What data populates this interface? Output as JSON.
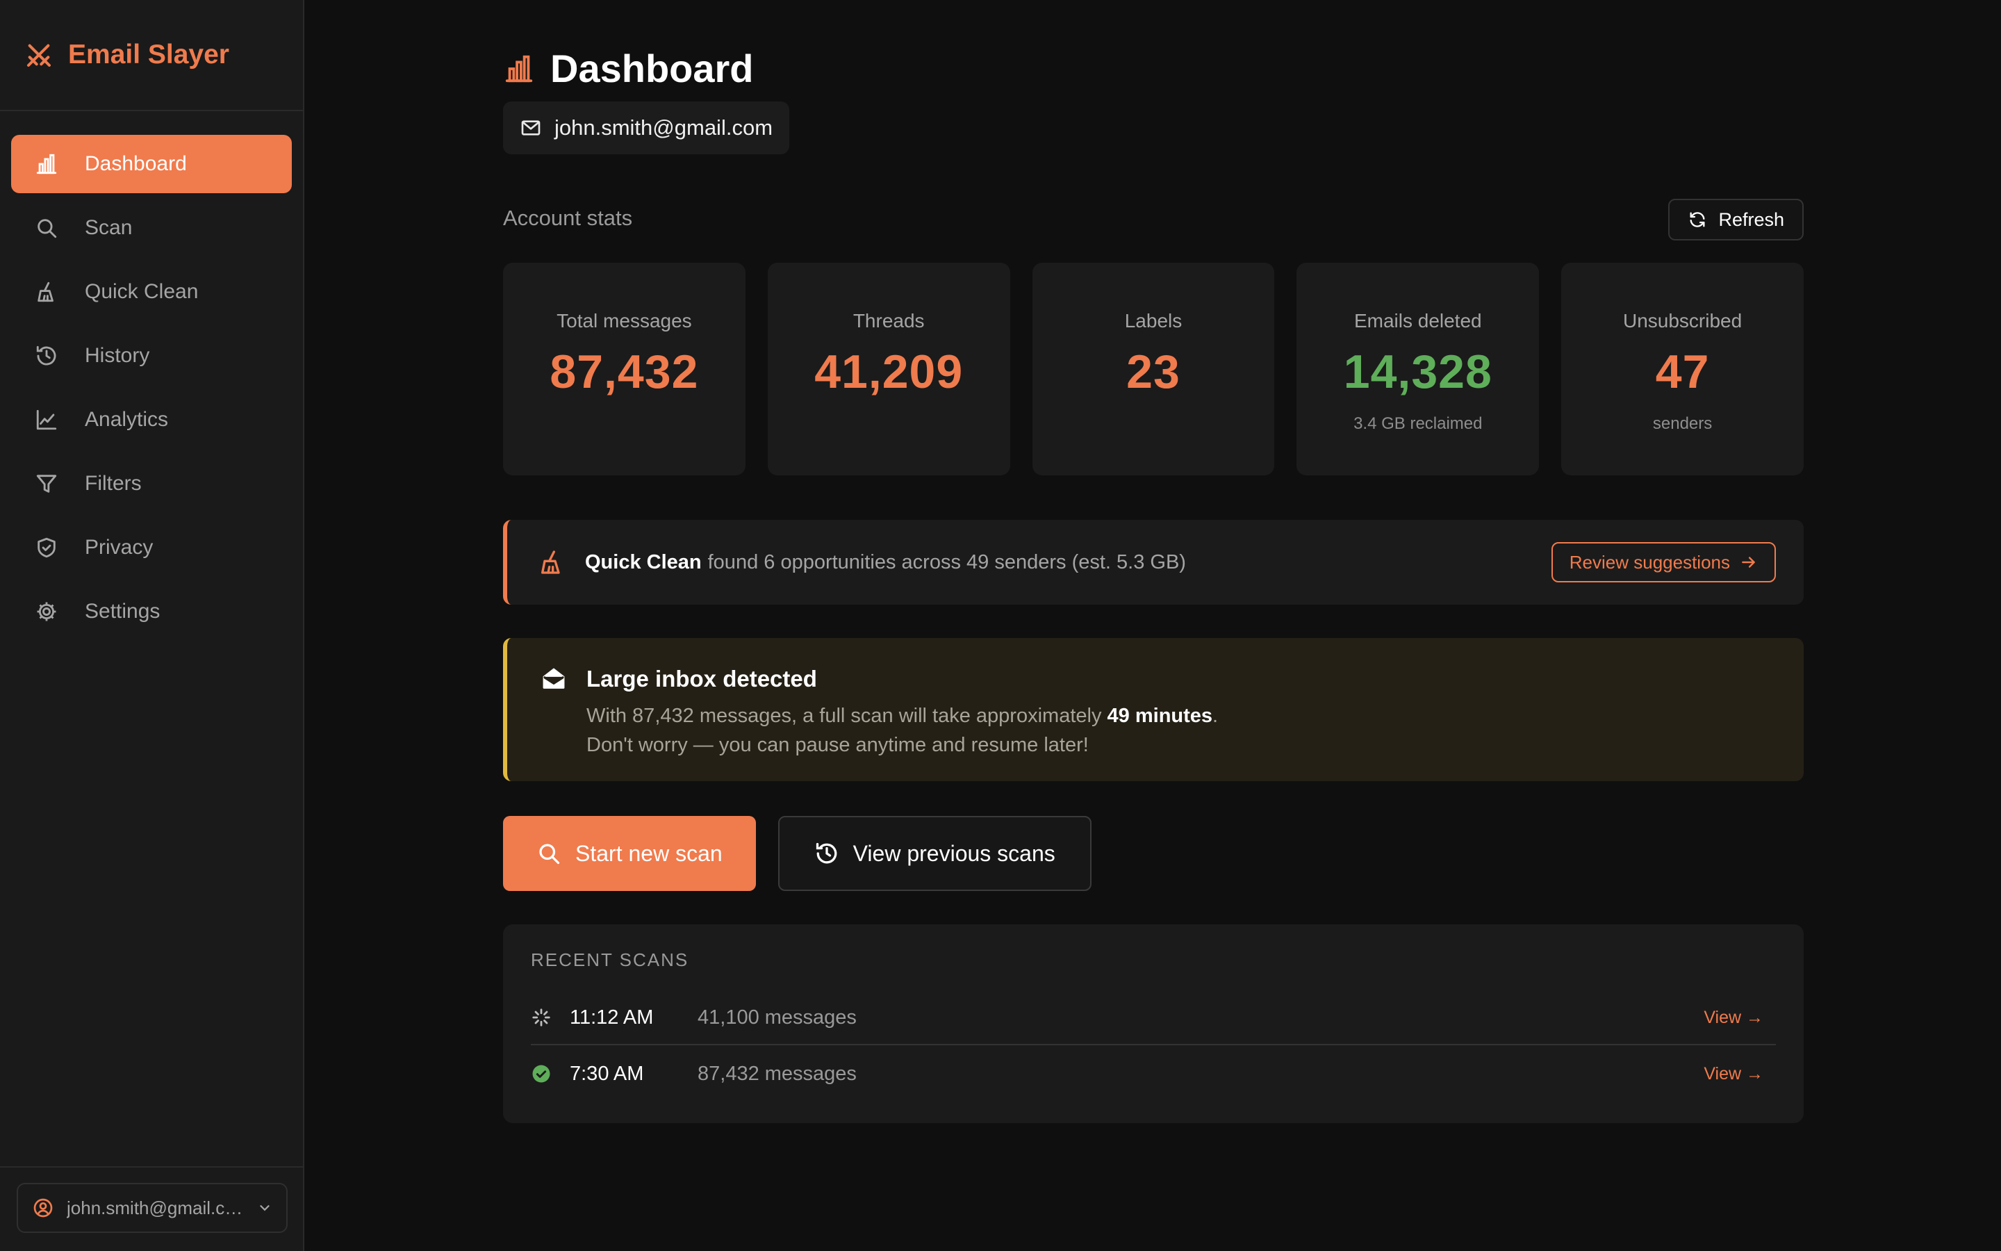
{
  "app": {
    "name": "Email Slayer"
  },
  "sidebar": {
    "items": [
      {
        "label": "Dashboard",
        "icon": "bar-chart-icon",
        "active": true
      },
      {
        "label": "Scan",
        "icon": "search-icon"
      },
      {
        "label": "Quick Clean",
        "icon": "broom-icon"
      },
      {
        "label": "History",
        "icon": "history-icon"
      },
      {
        "label": "Analytics",
        "icon": "line-chart-icon"
      },
      {
        "label": "Filters",
        "icon": "filter-icon"
      },
      {
        "label": "Privacy",
        "icon": "shield-icon"
      },
      {
        "label": "Settings",
        "icon": "gear-icon"
      }
    ],
    "account": {
      "label": "john.smith@gmail.com",
      "icon": "user-circle-icon"
    }
  },
  "header": {
    "title": "Dashboard",
    "email": "john.smith@gmail.com"
  },
  "stats": {
    "heading": "Account stats",
    "refresh_label": "Refresh",
    "cards": [
      {
        "label": "Total messages",
        "value": "87,432",
        "sub": ""
      },
      {
        "label": "Threads",
        "value": "41,209",
        "sub": ""
      },
      {
        "label": "Labels",
        "value": "23",
        "sub": ""
      },
      {
        "label": "Emails deleted",
        "value": "14,328",
        "sub": "3.4 GB reclaimed"
      },
      {
        "label": "Unsubscribed",
        "value": "47",
        "sub": "senders"
      }
    ]
  },
  "quick_clean": {
    "title": "Quick Clean",
    "text": "found 6 opportunities across 49 senders (est. 5.3 GB)",
    "button": "Review suggestions"
  },
  "warning": {
    "title": "Large inbox detected",
    "line1_pre": "With 87,432 messages, a full scan will take approximately",
    "line1_bold": "49 minutes",
    "line1_post": ".",
    "line2": "Don't worry — you can pause anytime and resume later!"
  },
  "actions": {
    "primary": "Start new scan",
    "secondary": "View previous scans"
  },
  "recent": {
    "heading": "RECENT SCANS",
    "rows": [
      {
        "time": "11:12 AM",
        "count": "41,100 messages",
        "status": "in-progress",
        "view": "View →"
      },
      {
        "time": "7:30 AM",
        "count": "87,432 messages",
        "status": "complete",
        "view": "View →"
      }
    ]
  },
  "colors": {
    "accent": "#f07b4d",
    "success": "#5fae5a",
    "warning": "#e0b93f",
    "background": "#0f0f0f",
    "sidebar": "#1a1a1a"
  }
}
